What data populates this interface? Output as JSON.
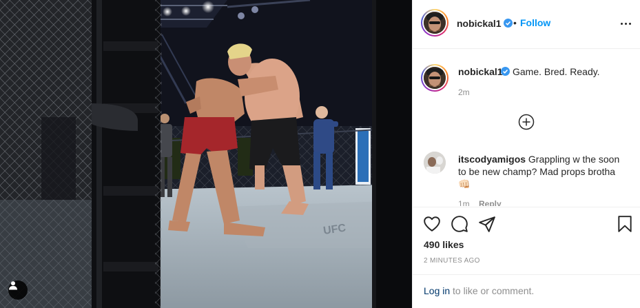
{
  "post": {
    "author": {
      "username": "nobickal1",
      "verified": true,
      "avatar_icon": "profile-photo"
    },
    "follow_label": "Follow",
    "separator": "•",
    "caption": {
      "username": "nobickal1",
      "text": "Game. Bred. Ready.",
      "time_ago": "2m"
    },
    "comments": [
      {
        "username": "itscodyamigos",
        "text": "Grappling w the soon to be new champ? Mad props brotha",
        "emoji": "👊🏻",
        "time_ago": "1m",
        "reply_label": "Reply"
      }
    ],
    "likes": "490 likes",
    "timestamp": "2 MINUTES AGO",
    "login": {
      "link_label": "Log in",
      "rest": " to like or comment."
    }
  },
  "photo": {
    "subject": "two fighters grappling in an octagon cage",
    "user_tag_icon": "user-tag-icon"
  },
  "colors": {
    "link_blue": "#0095f6",
    "login_blue": "#00376b",
    "muted": "#8e8e8e",
    "text": "#262626",
    "verified": "#3897f0"
  }
}
